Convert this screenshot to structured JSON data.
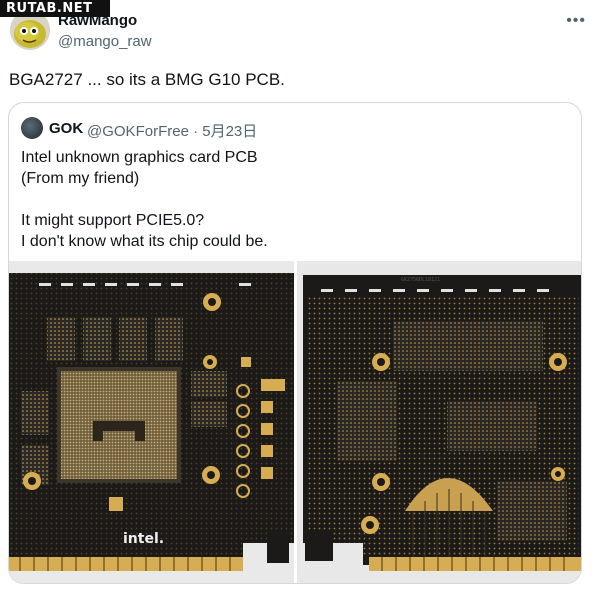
{
  "watermark": "RUTAB.NET",
  "tweet": {
    "author_name": "RawMango",
    "author_handle": "@mango_raw",
    "more_icon": "more-dots-icon",
    "text": "BGA2727 ... so its a BMG G10 PCB."
  },
  "quote": {
    "author_name": "GOK",
    "author_handle": "@GOKForFree · 5月23日",
    "lines": [
      "Intel unknown graphics card PCB",
      "(From my friend)",
      "",
      "It might support PCIE5.0?",
      "I don't know what its chip could be."
    ],
    "photo_left_label": "intel.",
    "photo_right_label": "GK2756DL18121"
  },
  "colors": {
    "pcb": "#1b1a18",
    "gold": "#d6ad52",
    "text": "#0f1419",
    "muted": "#536471",
    "border": "#cfd9de"
  }
}
